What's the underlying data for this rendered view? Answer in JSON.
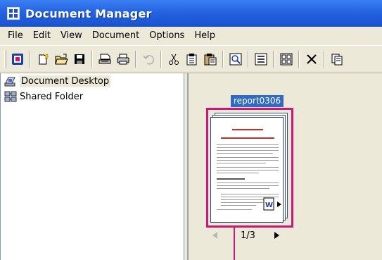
{
  "window": {
    "title": "Document Manager"
  },
  "menu": [
    "File",
    "Edit",
    "View",
    "Document",
    "Options",
    "Help"
  ],
  "toolbar": {
    "buttons": [
      "app-logo-icon",
      "new-document-icon",
      "open-folder-icon",
      "save-icon",
      "scan-icon",
      "print-icon",
      "undo-icon",
      "cut-icon",
      "copy-icon",
      "paste-icon",
      "zoom-icon",
      "details-view-icon",
      "thumbnails-view-icon",
      "delete-icon",
      "properties-icon"
    ]
  },
  "tree": {
    "items": [
      {
        "label": "Document Desktop",
        "icon": "desktop-icon",
        "selected": true
      },
      {
        "label": "Shared Folder",
        "icon": "shared-folder-icon",
        "selected": false
      }
    ]
  },
  "document": {
    "name": "report0306",
    "page_indicator": "1/3",
    "badge": "word-document-icon"
  },
  "colors": {
    "titlebar": "#2563e0",
    "selection": "#316ac5",
    "highlight_border": "#c8197a",
    "chrome": "#ece9d8"
  }
}
